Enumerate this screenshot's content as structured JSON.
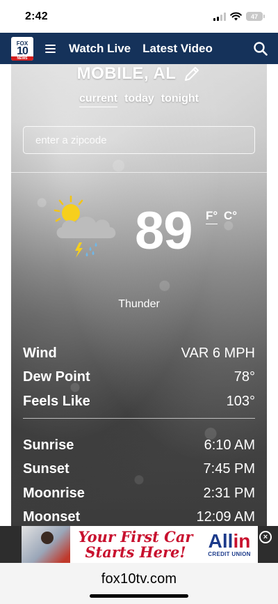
{
  "status_bar": {
    "time": "2:42",
    "battery": "47"
  },
  "navbar": {
    "logo": {
      "top": "FOX",
      "number": "10",
      "bottom": "NEWS"
    },
    "links": [
      "Watch Live",
      "Latest Video"
    ]
  },
  "weather": {
    "location": "MOBILE, AL",
    "tabs": [
      "current",
      "today",
      "tonight"
    ],
    "active_tab": "current",
    "zip_placeholder": "enter a zipcode",
    "temperature": "89",
    "units": {
      "fahrenheit": "F°",
      "celsius": "C°",
      "selected": "F°"
    },
    "condition": "Thunder",
    "details": [
      {
        "label": "Wind",
        "value": "VAR 6 MPH"
      },
      {
        "label": "Dew Point",
        "value": "78°"
      },
      {
        "label": "Feels Like",
        "value": "103°"
      }
    ],
    "astronomy": [
      {
        "label": "Sunrise",
        "value": "6:10 AM"
      },
      {
        "label": "Sunset",
        "value": "7:45 PM"
      },
      {
        "label": "Moonrise",
        "value": "2:31 PM"
      },
      {
        "label": "Moonset",
        "value": "12:09 AM"
      }
    ]
  },
  "ad": {
    "headline_line1": "Your First Car",
    "headline_line2": "Starts Here!",
    "brand_main_a": "All",
    "brand_main_b": "in",
    "brand_sub": "CREDIT UNION",
    "close_glyph": "×"
  },
  "browser": {
    "url": "fox10tv.com"
  },
  "colors": {
    "nav_bg": "#15325a",
    "accent_red": "#c8102e",
    "brand_blue": "#1b3a8a"
  }
}
